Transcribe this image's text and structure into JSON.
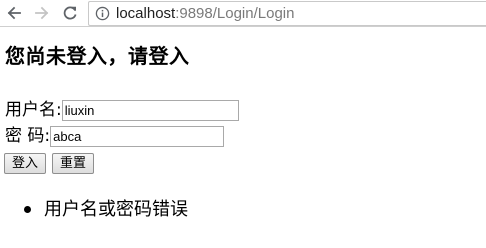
{
  "browser": {
    "url_host": "localhost",
    "url_rest": ":9898/Login/Login",
    "icons": {
      "back": "back-arrow-icon",
      "forward": "forward-arrow-icon",
      "reload": "reload-icon",
      "info": "info-icon"
    }
  },
  "page": {
    "title": "您尚未登入，请登入",
    "username_label": "用户名:",
    "username_value": "liuxin",
    "password_label": "密 码:",
    "password_value": "abca",
    "login_button": "登入",
    "reset_button": "重置",
    "errors": [
      "用户名或密码错误"
    ]
  }
}
